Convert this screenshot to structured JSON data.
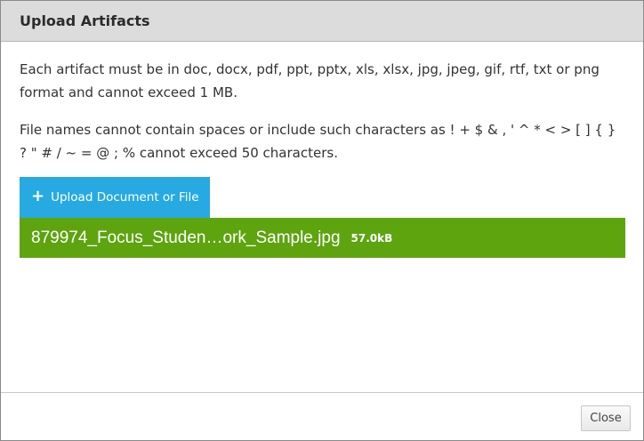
{
  "dialog": {
    "title": "Upload Artifacts",
    "instructions": [
      "Each artifact must be in doc, docx, pdf, ppt, pptx, xls, xlsx, jpg, jpeg, gif, rtf, txt or png format and cannot exceed 1 MB.",
      "File names cannot contain spaces or include such characters as ! + $ & , ' ^ * < > [ ] { } ? \" # / ~ = @ ; % cannot exceed 50 characters."
    ],
    "upload_button": {
      "icon": "plus-icon",
      "label": "Upload Document or File",
      "color": "#27aae1"
    },
    "files": [
      {
        "name": "879974_Focus_Studen…ork_Sample.jpg",
        "size": "57.0kB",
        "color": "#5da40f"
      }
    ],
    "footer": {
      "close_label": "Close"
    }
  }
}
